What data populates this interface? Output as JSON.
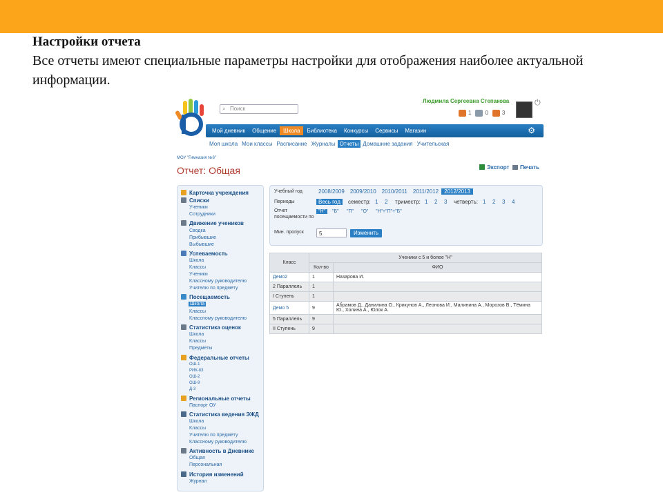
{
  "slide": {
    "title": "Настройки отчета",
    "body": "Все отчеты имеют специальные параметры настройки для отображения наиболее актуальной информации."
  },
  "header": {
    "search_placeholder": "Поиск",
    "user_name": "Людмила Сергеевна Степакова",
    "badges": [
      {
        "icon": "mail-icon",
        "count": "1",
        "color": "#e0752a"
      },
      {
        "icon": "user-icon",
        "count": "0",
        "color": "#8a9aa8"
      },
      {
        "icon": "group-icon",
        "count": "3",
        "color": "#e0752a"
      }
    ]
  },
  "nav": {
    "items": [
      "Мой дневник",
      "Общение",
      "Школа",
      "Библиотека",
      "Конкурсы",
      "Сервисы",
      "Магазин"
    ],
    "active": "Школа"
  },
  "subnav": {
    "items": [
      "Моя школа",
      "Мои классы",
      "Расписание",
      "Журналы",
      "Отчеты",
      "Домашние задания",
      "Учительская"
    ],
    "active": "Отчеты"
  },
  "page": {
    "school": "МОУ \"Гимназия №6\"",
    "title": "Отчет: Общая",
    "export": "Экспорт",
    "print": "Печать"
  },
  "sidebar": {
    "sections": [
      {
        "title": "Карточка учреждения",
        "icon_color": "#e8a020",
        "links": []
      },
      {
        "title": "Списки",
        "icon_color": "#6a7a8a",
        "links": [
          "Ученики",
          "Сотрудники"
        ]
      },
      {
        "title": "Движение учеников",
        "icon_color": "#6a7a8a",
        "links": [
          "Сводка",
          "Прибывшие",
          "Выбывшие"
        ]
      },
      {
        "title": "Успеваемость",
        "icon_color": "#4a7ab8",
        "links": [
          "Школа",
          "Классы",
          "Ученики",
          "Классному руководителю",
          "Учителю по предмету"
        ]
      },
      {
        "title": "Посещаемость",
        "icon_color": "#3a8ac8",
        "links": [
          "Школа",
          "Классы",
          "Классному руководителю"
        ],
        "active_link": "Школа"
      },
      {
        "title": "Статистика оценок",
        "icon_color": "#6a7a8a",
        "links": [
          "Школа",
          "Классы",
          "Предметы"
        ]
      },
      {
        "title": "Федеральные отчеты",
        "icon_color": "#e8a020",
        "links": [
          "ОШ-1",
          "РИК-83",
          "ОШ-2",
          "ОШ-9",
          "Д-3"
        ]
      },
      {
        "title": "Региональные отчеты",
        "icon_color": "#e8a020",
        "links": [
          "Паспорт ОУ"
        ]
      },
      {
        "title": "Статистика ведения ЭЖД",
        "icon_color": "#4a6a8a",
        "links": [
          "Школа",
          "Классы",
          "Учителю по предмету",
          "Классному руководителю"
        ]
      },
      {
        "title": "Активность в Дневнике",
        "icon_color": "#6a7a8a",
        "links": [
          "Общая",
          "Персональная"
        ]
      },
      {
        "title": "История изменений",
        "icon_color": "#4a6a8a",
        "links": [
          "Журнал"
        ]
      }
    ]
  },
  "filter": {
    "year_label": "Учебный год",
    "years": [
      "2008/2009",
      "2009/2010",
      "2010/2011",
      "2011/2012",
      "2012/2013"
    ],
    "year_selected": "2012/2013",
    "period_label": "Периоды",
    "period_all": "Весь год",
    "semester_label": "семестр:",
    "semesters": [
      "1",
      "2"
    ],
    "trimester_label": "триместр:",
    "trimesters": [
      "1",
      "2",
      "3"
    ],
    "quarter_label": "четверть:",
    "quarters": [
      "1",
      "2",
      "3",
      "4"
    ],
    "attendance_label_1": "Отчет",
    "attendance_label_2": "посещаемости по",
    "attendance_options": [
      "\"Н\"",
      "\"Б\"",
      "\"П\"",
      "\"О\"",
      "\"Н\"+\"П\"+\"Б\""
    ],
    "attendance_selected": "\"Н\"",
    "min_label": "Мин. пропуск",
    "min_value": "5",
    "change_button": "Изменить"
  },
  "table": {
    "col_class": "Класс",
    "group_header": "Ученики с 5 и более \"Н\"",
    "col_count": "Кол-во",
    "col_fio": "ФИО",
    "rows": [
      {
        "class": "Демо2",
        "count": "1",
        "fio": "Назарова И.",
        "link": true,
        "gray": false
      },
      {
        "class": "2 Параллель",
        "count": "1",
        "fio": "",
        "link": false,
        "gray": true
      },
      {
        "class": "I Ступень",
        "count": "1",
        "fio": "",
        "link": false,
        "gray": true
      },
      {
        "class": "Демо 5",
        "count": "9",
        "fio": "Абрамов Д., Данилина О., Крикунов А., Леонова И., Малинина А., Морозов В., Тёмина Ю., Холина А., Юлок А.",
        "link": true,
        "gray": false
      },
      {
        "class": "5 Параллель",
        "count": "9",
        "fio": "",
        "link": false,
        "gray": true
      },
      {
        "class": "II Ступень",
        "count": "9",
        "fio": "",
        "link": false,
        "gray": true
      }
    ]
  }
}
